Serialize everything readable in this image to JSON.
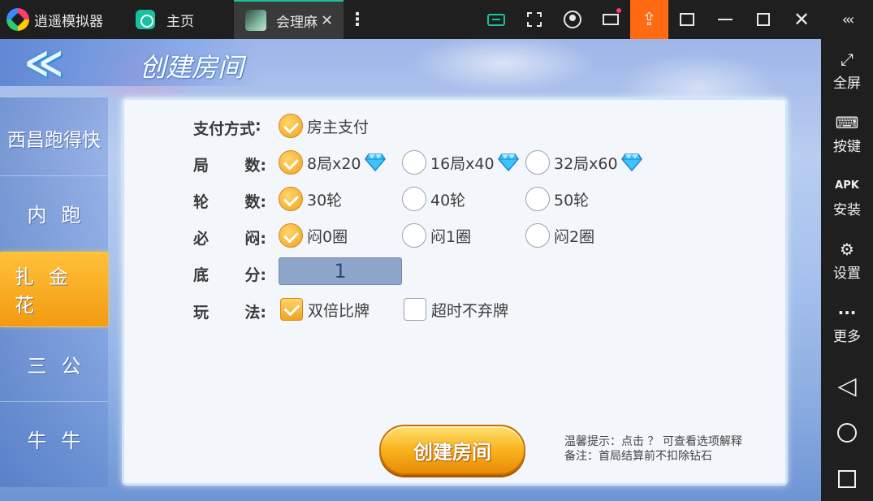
{
  "emulator": {
    "app_title": "逍遥模拟器",
    "home_tab_label": "主页",
    "game_tab_label": "会理麻",
    "close_glyph": "✕",
    "kebab_glyph": "⋮",
    "upload_glyph": "⇪",
    "collapse_glyph": "‹‹‹",
    "accent_color": "#16c2a0",
    "upload_color": "#ff6a13"
  },
  "sidebar": {
    "items": [
      {
        "label": "全屏",
        "icon": "fullscreen-icon",
        "glyph": "⤢"
      },
      {
        "label": "按键",
        "icon": "keyboard-icon",
        "glyph": "⌨"
      },
      {
        "label": "安装",
        "icon": "apk-icon",
        "glyph": "APK"
      },
      {
        "label": "设置",
        "icon": "gear-icon",
        "glyph": "⚙"
      },
      {
        "label": "更多",
        "icon": "more-icon",
        "glyph": "···"
      }
    ],
    "nav_back_glyph": "◁"
  },
  "game": {
    "page_title": "创建房间",
    "back_glyph": "≪",
    "tabs": [
      {
        "label": "西昌跑得快",
        "active": false
      },
      {
        "label": "内跑",
        "active": false
      },
      {
        "label": "扎金花",
        "active": true
      },
      {
        "label": "三公",
        "active": false
      },
      {
        "label": "牛牛",
        "active": false
      }
    ],
    "options": {
      "payment": {
        "label_a": "支付方式",
        "label_b": ":",
        "choices": [
          {
            "text": "房主支付",
            "selected": true
          }
        ]
      },
      "rounds": {
        "label_a": "局",
        "label_b": "数:",
        "choices": [
          {
            "text": "8局x20",
            "selected": true,
            "gem": true
          },
          {
            "text": "16局x40",
            "selected": false,
            "gem": true
          },
          {
            "text": "32局x60",
            "selected": false,
            "gem": true
          }
        ]
      },
      "turns": {
        "label_a": "轮",
        "label_b": "数:",
        "choices": [
          {
            "text": "30轮",
            "selected": true
          },
          {
            "text": "40轮",
            "selected": false
          },
          {
            "text": "50轮",
            "selected": false
          }
        ]
      },
      "blind": {
        "label_a": "必",
        "label_b": "闷:",
        "choices": [
          {
            "text": "闷0圈",
            "selected": true
          },
          {
            "text": "闷1圈",
            "selected": false
          },
          {
            "text": "闷2圈",
            "selected": false
          }
        ]
      },
      "base_score": {
        "label_a": "底",
        "label_b": "分:",
        "value": "1"
      },
      "play": {
        "label_a": "玩",
        "label_b": "法:",
        "choices": [
          {
            "text": "双倍比牌",
            "checked": true
          },
          {
            "text": "超时不弃牌",
            "checked": false
          }
        ]
      }
    },
    "create_button_label": "创建房间",
    "tip_line1": "温馨提示：点击 ？ 可查看选项解释",
    "tip_line2": "备注：首局结算前不扣除钻石"
  }
}
